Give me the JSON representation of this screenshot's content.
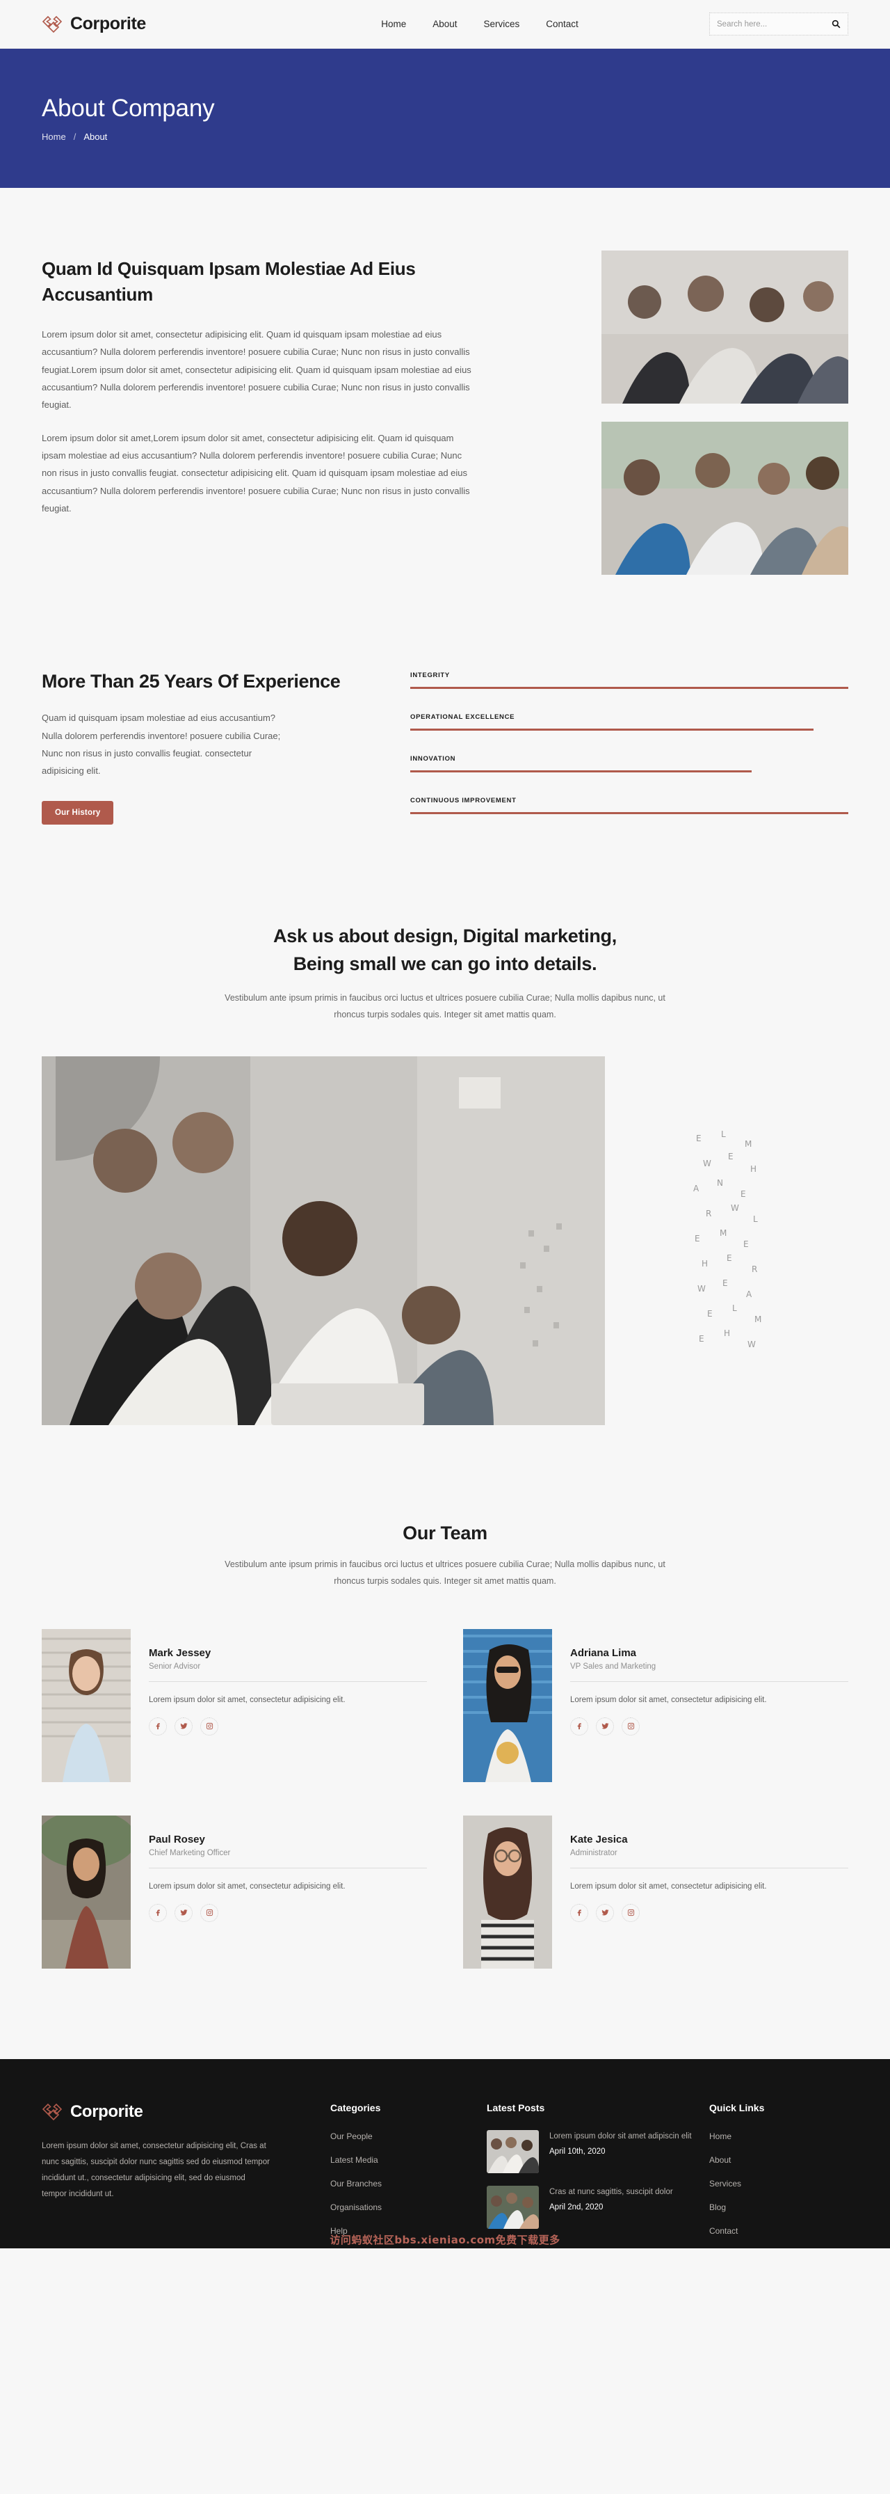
{
  "header": {
    "brand": "Corporite",
    "logo_icon": "diamond-chevron-logo",
    "nav": [
      {
        "label": "Home"
      },
      {
        "label": "About"
      },
      {
        "label": "Services"
      },
      {
        "label": "Contact"
      }
    ],
    "search": {
      "placeholder": "Search here...",
      "value": "",
      "icon": "search-icon"
    }
  },
  "banner": {
    "title": "About Company",
    "breadcrumb_home": "Home",
    "breadcrumb_sep": "/",
    "breadcrumb_current": "About",
    "bg_color": "#2f3b8c"
  },
  "about": {
    "heading": "Quam Id Quisquam Ipsam Molestiae Ad Eius Accusantium",
    "paragraph1": "Lorem ipsum dolor sit amet, consectetur adipisicing elit. Quam id quisquam ipsam molestiae ad eius accusantium? Nulla dolorem perferendis inventore! posuere cubilia Curae; Nunc non risus in justo convallis feugiat.Lorem ipsum dolor sit amet, consectetur adipisicing elit. Quam id quisquam ipsam molestiae ad eius accusantium? Nulla dolorem perferendis inventore! posuere cubilia Curae; Nunc non risus in justo convallis feugiat.",
    "paragraph2": "Lorem ipsum dolor sit amet,Lorem ipsum dolor sit amet, consectetur adipisicing elit. Quam id quisquam ipsam molestiae ad eius accusantium? Nulla dolorem perferendis inventore! posuere cubilia Curae; Nunc non risus in justo convallis feugiat. consectetur adipisicing elit. Quam id quisquam ipsam molestiae ad eius accusantium? Nulla dolorem perferendis inventore! posuere cubilia Curae; Nunc non risus in justo convallis feugiat."
  },
  "experience": {
    "heading": "More Than 25 Years Of Experience",
    "paragraph": "Quam id quisquam ipsam molestiae ad eius accusantium? Nulla dolorem perferendis inventore! posuere cubilia Curae; Nunc non risus in justo convallis feugiat. consectetur adipisicing elit.",
    "button": "Our History",
    "accent_color": "#b05a4c",
    "skills": [
      {
        "label": "INTEGRITY",
        "percent": 100
      },
      {
        "label": "OPERATIONAL EXCELLENCE",
        "percent": 92
      },
      {
        "label": "INNOVATION",
        "percent": 78
      },
      {
        "label": "CONTINUOUS IMPROVEMENT",
        "percent": 100
      }
    ]
  },
  "ask": {
    "heading_line1": "Ask us about design, Digital marketing,",
    "heading_line2": "Being small we can go into details.",
    "paragraph": "Vestibulum ante ipsum primis in faucibus orci luctus et ultrices posuere cubilia Curae; Nulla mollis dapibus nunc, ut rhoncus turpis sodales quis. Integer sit amet mattis quam."
  },
  "team": {
    "heading": "Our Team",
    "paragraph": "Vestibulum ante ipsum primis in faucibus orci luctus et ultrices posuere cubilia Curae; Nulla mollis dapibus nunc, ut rhoncus turpis sodales quis. Integer sit amet mattis quam.",
    "bio": "Lorem ipsum dolor sit amet, consectetur adipisicing elit.",
    "members": [
      {
        "name": "Mark Jessey",
        "role": "Senior Advisor",
        "bio": "Lorem ipsum dolor sit amet, consectetur adipisicing elit."
      },
      {
        "name": "Adriana Lima",
        "role": "VP Sales and Marketing",
        "bio": "Lorem ipsum dolor sit amet, consectetur adipisicing elit."
      },
      {
        "name": "Paul Rosey",
        "role": "Chief Marketing Officer",
        "bio": "Lorem ipsum dolor sit amet, consectetur adipisicing elit."
      },
      {
        "name": "Kate Jesica",
        "role": "Administrator",
        "bio": "Lorem ipsum dolor sit amet, consectetur adipisicing elit."
      }
    ],
    "social_icons": [
      "facebook-icon",
      "twitter-icon",
      "instagram-icon"
    ]
  },
  "footer": {
    "brand": "Corporite",
    "about": "Lorem ipsum dolor sit amet, consectetur adipisicing elit, Cras at nunc sagittis, suscipit dolor nunc sagittis sed do eiusmod tempor incididunt ut., consectetur adipisicing elit, sed do eiusmod tempor incididunt ut.",
    "categories_head": "Categories",
    "categories": [
      {
        "label": "Our People"
      },
      {
        "label": "Latest Media"
      },
      {
        "label": "Our Branches"
      },
      {
        "label": "Organisations"
      },
      {
        "label": "Help"
      }
    ],
    "posts_head": "Latest Posts",
    "posts": [
      {
        "title": "Lorem ipsum dolor sit amet adipiscin elit",
        "date": "April 10th, 2020"
      },
      {
        "title": "Cras at nunc sagittis, suscipit dolor",
        "date": "April 2nd, 2020"
      }
    ],
    "quick_head": "Quick Links",
    "quick_links": [
      {
        "label": "Home"
      },
      {
        "label": "About"
      },
      {
        "label": "Services"
      },
      {
        "label": "Blog"
      },
      {
        "label": "Contact"
      }
    ],
    "watermark": "访问蚂蚁社区bbs.xieniao.com免费下载更多"
  }
}
